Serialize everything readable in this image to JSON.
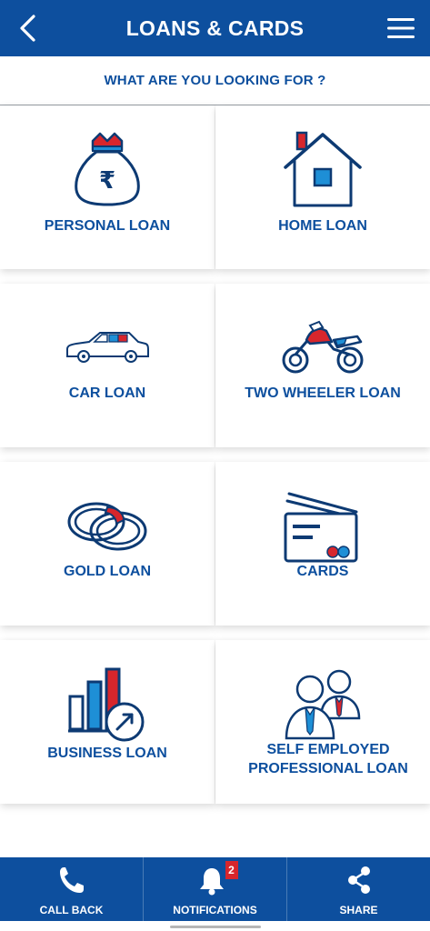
{
  "header": {
    "title": "LOANS & CARDS",
    "back_icon": "back-chevron-icon",
    "menu_icon": "hamburger-menu-icon"
  },
  "subheading": "WHAT ARE YOU LOOKING FOR ?",
  "tiles": [
    {
      "label": "PERSONAL LOAN",
      "icon": "money-bag-rupee-icon"
    },
    {
      "label": "HOME LOAN",
      "icon": "house-icon"
    },
    {
      "label": "CAR LOAN",
      "icon": "car-icon"
    },
    {
      "label": "TWO WHEELER LOAN",
      "icon": "motorcycle-icon"
    },
    {
      "label": "GOLD LOAN",
      "icon": "rings-icon"
    },
    {
      "label": "CARDS",
      "icon": "credit-card-icon"
    },
    {
      "label": "BUSINESS LOAN",
      "icon": "bar-chart-growth-icon"
    },
    {
      "label_line1": "SELF EMPLOYED",
      "label_line2": "PROFESSIONAL LOAN",
      "icon": "professionals-icon"
    }
  ],
  "footer": {
    "call_back": "CALL BACK",
    "notifications": "NOTIFICATIONS",
    "notifications_count": "2",
    "share": "SHARE"
  },
  "colors": {
    "brand_blue": "#0d4f9e",
    "accent_red": "#d7262c",
    "icon_light_blue": "#1e8fd6"
  }
}
